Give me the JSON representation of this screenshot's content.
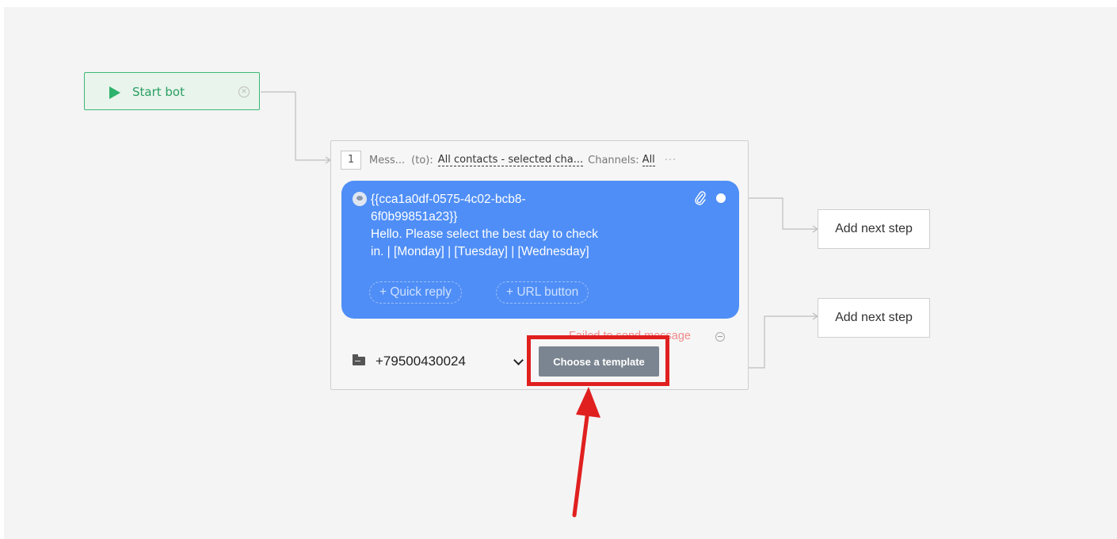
{
  "start_node": {
    "label": "Start bot"
  },
  "message_step": {
    "number": "1",
    "type_label": "Mess...",
    "to_label": "(to):",
    "recipients": "All contacts - selected cha...",
    "channels_label": "Channels:",
    "channels_value": "All",
    "more": "···",
    "bubble": {
      "line1": "{{cca1a0df-0575-4c02-bcb8-",
      "line2": "6f0b99851a23}}",
      "line3": "Hello. Please select the best day to check",
      "line4": "in. | [Monday] | [Tuesday] | [Wednesday]"
    },
    "quick_reply_label": "+ Quick reply",
    "url_button_label": "+ URL button",
    "failed_text": "Failed to send message",
    "phone_number": "+79500430024",
    "choose_template_label": "Choose a template"
  },
  "next_steps": {
    "add_next_step_1": "Add next step",
    "add_next_step_2": "Add next step"
  },
  "colors": {
    "bubble": "#4f8ef6",
    "start_border": "#3cb878",
    "highlight": "#e0201f",
    "button": "#7b8591"
  }
}
